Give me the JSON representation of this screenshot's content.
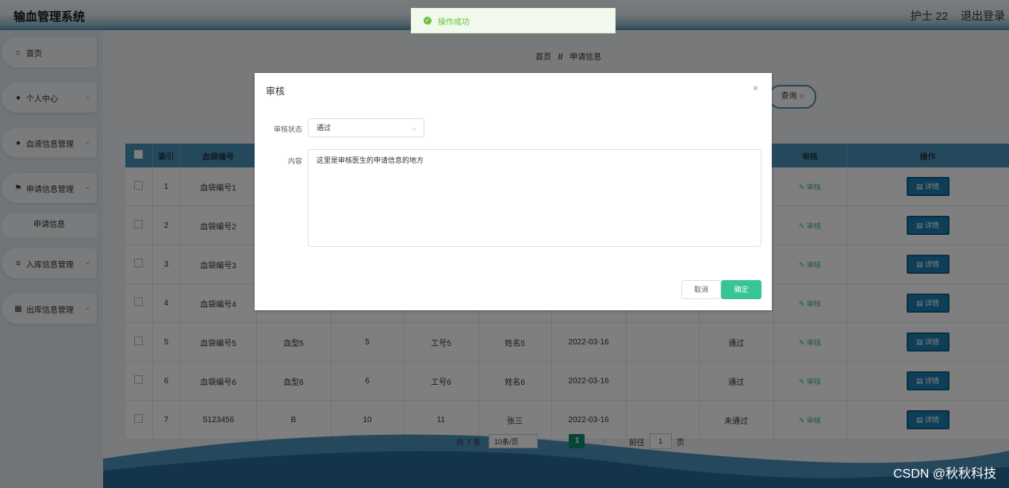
{
  "app": {
    "title": "输血管理系统"
  },
  "header": {
    "user": "护士 22",
    "logout": "退出登录"
  },
  "sidebar": {
    "items": [
      {
        "label": "首页",
        "icon": "home-icon"
      },
      {
        "label": "个人中心",
        "icon": "user-icon"
      },
      {
        "label": "血液信息管理",
        "icon": "user-icon"
      },
      {
        "label": "申请信息管理",
        "icon": "flag-icon"
      },
      {
        "label": "入库信息管理",
        "icon": "menu-icon"
      },
      {
        "label": "出库信息管理",
        "icon": "grid-icon"
      }
    ],
    "sub_item": "申请信息"
  },
  "breadcrumb": {
    "home": "首页",
    "sep": "//",
    "current": "申请信息"
  },
  "search": {
    "button": "查询"
  },
  "table": {
    "columns": [
      "索引",
      "血袋编号",
      "",
      "",
      "",
      "",
      "",
      "",
      "",
      "审核",
      "操作"
    ],
    "rows": [
      {
        "index": "1",
        "bag": "血袋编号1",
        "type": "",
        "amount": "",
        "job": "",
        "name": "",
        "date": "",
        "remark": "",
        "status": "",
        "audit": "审核",
        "action": "详情"
      },
      {
        "index": "2",
        "bag": "血袋编号2",
        "type": "",
        "amount": "",
        "job": "",
        "name": "",
        "date": "",
        "remark": "",
        "status": "",
        "audit": "审核",
        "action": "详情"
      },
      {
        "index": "3",
        "bag": "血袋编号3",
        "type": "",
        "amount": "",
        "job": "",
        "name": "",
        "date": "",
        "remark": "",
        "status": "",
        "audit": "审核",
        "action": "详情"
      },
      {
        "index": "4",
        "bag": "血袋编号4",
        "type": "",
        "amount": "",
        "job": "",
        "name": "",
        "date": "",
        "remark": "",
        "status": "",
        "audit": "审核",
        "action": "详情"
      },
      {
        "index": "5",
        "bag": "血袋编号5",
        "type": "血型5",
        "amount": "5",
        "job": "工号5",
        "name": "姓名5",
        "date": "2022-03-16",
        "remark": "",
        "status": "通过",
        "audit": "审核",
        "action": "详情"
      },
      {
        "index": "6",
        "bag": "血袋编号6",
        "type": "血型6",
        "amount": "6",
        "job": "工号6",
        "name": "姓名6",
        "date": "2022-03-16",
        "remark": "",
        "status": "通过",
        "audit": "审核",
        "action": "详情"
      },
      {
        "index": "7",
        "bag": "S123456",
        "type": "B",
        "amount": "10",
        "job": "11",
        "name": "张三",
        "date": "2022-03-16",
        "remark": "",
        "status": "未通过",
        "audit": "审核",
        "action": "详情"
      }
    ]
  },
  "pagination": {
    "total": "共 7 条",
    "page_size": "10条/页",
    "prev": "‹",
    "current": "1",
    "next": "›",
    "goto": "前往",
    "goto_value": "1",
    "page_unit": "页"
  },
  "toast": {
    "text": "操作成功"
  },
  "dialog": {
    "title": "审核",
    "status_label": "审核状态",
    "status_value": "通过",
    "content_label": "内容",
    "content_value": "这里是审核医生的申请信息的地方",
    "cancel": "取消",
    "confirm": "确定"
  },
  "watermark": "CSDN @秋秋科技"
}
